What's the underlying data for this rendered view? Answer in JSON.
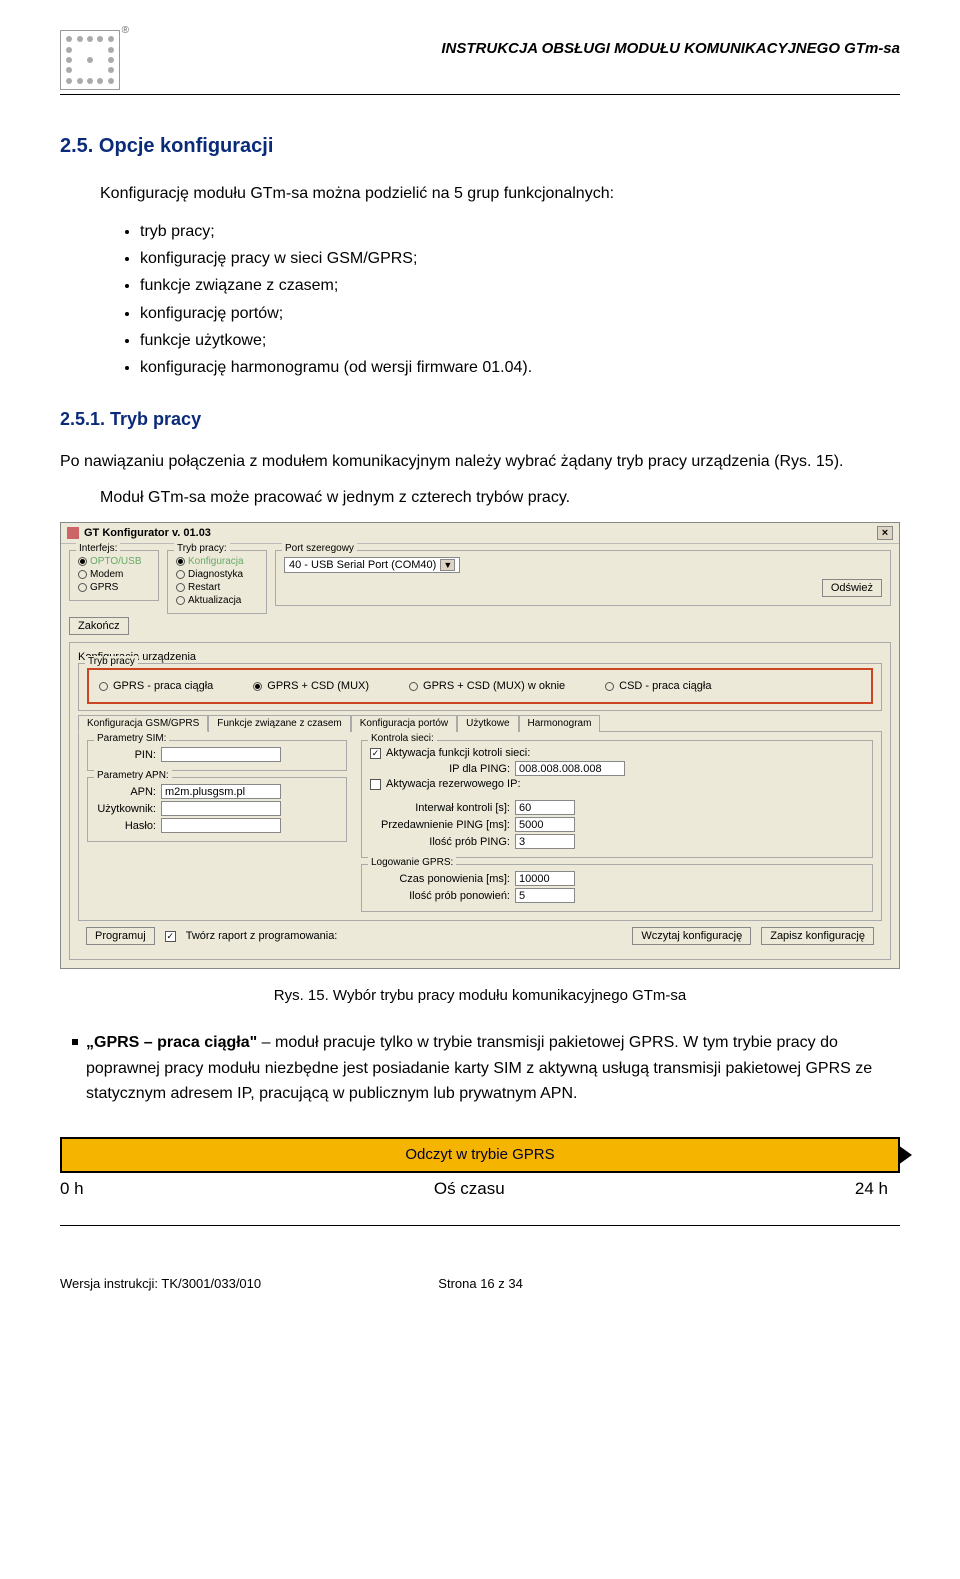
{
  "header": {
    "doc_title": "INSTRUKCJA OBSŁUGI MODUŁU KOMUNIKACYJNEGO GTm-sa"
  },
  "section": {
    "number_title": "2.5. Opcje konfiguracji",
    "intro": "Konfigurację modułu GTm-sa można podzielić na 5 grup funkcjonalnych:",
    "bullets": [
      "tryb pracy;",
      "konfigurację pracy w sieci GSM/GPRS;",
      "funkcje związane z czasem;",
      "konfigurację portów;",
      "funkcje użytkowe;",
      "konfigurację harmonogramu (od wersji firmware 01.04)."
    ]
  },
  "sub": {
    "number_title": "2.5.1. Tryb pracy",
    "p1": "Po nawiązaniu połączenia z modułem komunikacyjnym należy wybrać żądany tryb pracy urządzenia (Rys. 15).",
    "p2": "Moduł GTm-sa może pracować w jednym z czterech trybów pracy."
  },
  "config": {
    "title": "GT Konfigurator v. 01.03",
    "interfejs_legend": "Interfejs:",
    "interfejs_items": [
      "OPTO/USB",
      "Modem",
      "GPRS"
    ],
    "interfejs_sel": 0,
    "tryb_legend": "Tryb pracy:",
    "tryb_items": [
      "Konfiguracja",
      "Diagnostyka",
      "Restart",
      "Aktualizacja"
    ],
    "tryb_sel": 0,
    "port_legend": "Port szeregowy",
    "port_value": "40 - USB Serial Port (COM40)",
    "odswiez": "Odśwież",
    "zakoncz": "Zakończ",
    "konfig_legend": "Konfiguracja urządzenia",
    "trybpracy_legend": "Tryb pracy",
    "modes": [
      "GPRS - praca ciągła",
      "GPRS + CSD (MUX)",
      "GPRS + CSD (MUX) w oknie",
      "CSD - praca ciągła"
    ],
    "modes_sel": 1,
    "tabs": [
      "Konfiguracja GSM/GPRS",
      "Funkcje związane z czasem",
      "Konfiguracja portów",
      "Użytkowe",
      "Harmonogram"
    ],
    "tabs_sel": 0,
    "sim_legend": "Parametry SIM:",
    "pin_lbl": "PIN:",
    "apn_legend": "Parametry APN:",
    "apn_lbl": "APN:",
    "apn_val": "m2m.plusgsm.pl",
    "user_lbl": "Użytkownik:",
    "pass_lbl": "Hasło:",
    "kontrola_legend": "Kontrola sieci:",
    "chk1_lbl": "Aktywacja funkcji kotroli sieci:",
    "ping_ip_lbl": "IP dla PING:",
    "ping_ip_val": "008.008.008.008",
    "chk2_lbl": "Aktywacja rezerwowego IP:",
    "interval_lbl": "Interwał kontroli [s]:",
    "interval_val": "60",
    "przed_lbl": "Przedawnienie PING [ms]:",
    "przed_val": "5000",
    "ilosc_lbl": "Ilość prób PING:",
    "ilosc_val": "3",
    "log_legend": "Logowanie GPRS:",
    "czas_lbl": "Czas ponowienia [ms]:",
    "czas_val": "10000",
    "ilosc2_lbl": "Ilość prób ponowień:",
    "ilosc2_val": "5",
    "programuj": "Programuj",
    "tworz_raport": "Twórz raport z programowania:",
    "wczytaj": "Wczytaj konfigurację",
    "zapisz": "Zapisz konfigurację"
  },
  "caption": "Rys. 15. Wybór trybu pracy modułu komunikacyjnego GTm-sa",
  "desc": {
    "bold": "„GPRS – praca ciągła\"",
    "text": " – moduł pracuje tylko w trybie transmisji pakietowej GPRS. W tym trybie pracy do poprawnej pracy modułu niezbędne jest posiadanie karty SIM z aktywną usługą transmisji pakietowej GPRS ze statycznym adresem IP, pracującą w publicznym lub prywatnym APN."
  },
  "timeline": {
    "bar_label": "Odczyt  w trybie GPRS",
    "left": "0 h",
    "mid": "Oś czasu",
    "right": "24 h"
  },
  "footer": {
    "version": "Wersja instrukcji: TK/3001/033/010",
    "page": "Strona 16 z 34"
  }
}
